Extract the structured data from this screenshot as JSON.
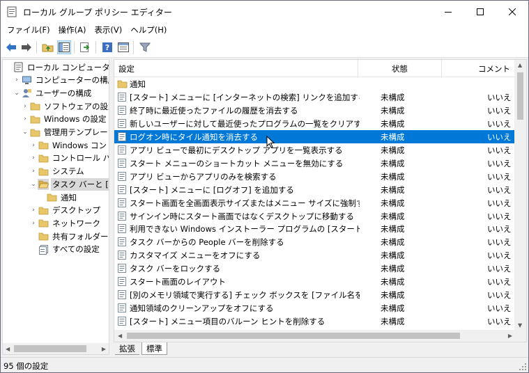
{
  "window": {
    "title": "ローカル グループ ポリシー エディター"
  },
  "menu": [
    "ファイル(F)",
    "操作(A)",
    "表示(V)",
    "ヘルプ(H)"
  ],
  "toolbar": {
    "icons": [
      "back-arrow-icon",
      "forward-arrow-icon",
      "up-folder-icon",
      "show-hide-tree-icon",
      "export-list-icon",
      "help-icon",
      "properties-icon",
      "filter-icon"
    ]
  },
  "tree": [
    {
      "label": "ローカル コンピューター ポリシ",
      "expander": "",
      "icon": "policy-icon",
      "level": 0
    },
    {
      "label": "コンピューターの構成",
      "expander": "›",
      "icon": "computer-icon",
      "level": 1
    },
    {
      "label": "ユーザーの構成",
      "expander": "⌄",
      "icon": "user-icon",
      "level": 1
    },
    {
      "label": "ソフトウェアの設定",
      "expander": "›",
      "icon": "folder-icon",
      "level": 2
    },
    {
      "label": "Windows の設定",
      "expander": "›",
      "icon": "folder-icon",
      "level": 2
    },
    {
      "label": "管理用テンプレート",
      "expander": "⌄",
      "icon": "folder-icon",
      "level": 2
    },
    {
      "label": "Windows コン",
      "expander": "›",
      "icon": "folder-icon",
      "level": 3
    },
    {
      "label": "コントロール パ",
      "expander": "›",
      "icon": "folder-icon",
      "level": 3
    },
    {
      "label": "システム",
      "expander": "›",
      "icon": "folder-icon",
      "level": 3
    },
    {
      "label": "タスク バーと [ス",
      "expander": "⌄",
      "icon": "folder-open-icon",
      "level": 3,
      "selected": true
    },
    {
      "label": "通知",
      "expander": "",
      "icon": "folder-icon",
      "level": 4
    },
    {
      "label": "デスクトップ",
      "expander": "›",
      "icon": "folder-icon",
      "level": 3
    },
    {
      "label": "ネットワーク",
      "expander": "›",
      "icon": "folder-icon",
      "level": 3
    },
    {
      "label": "共有フォルダー",
      "expander": "",
      "icon": "folder-icon",
      "level": 3
    },
    {
      "label": "すべての設定",
      "expander": "",
      "icon": "all-settings-icon",
      "level": 3
    }
  ],
  "list": {
    "columns": [
      "設定",
      "状態",
      "コメント"
    ],
    "rows": [
      {
        "name": "通知",
        "state": "",
        "comment": "",
        "icon": "folder-icon"
      },
      {
        "name": "[スタート] メニューに [インターネットの検索] リンクを追加する",
        "state": "未構成",
        "comment": "いいえ",
        "icon": "setting-icon"
      },
      {
        "name": "終了時に最近使ったファイルの履歴を消去する",
        "state": "未構成",
        "comment": "いいえ",
        "icon": "setting-icon"
      },
      {
        "name": "新しいユーザーに対して最近使ったプログラムの一覧をクリアする",
        "state": "未構成",
        "comment": "いいえ",
        "icon": "setting-icon"
      },
      {
        "name": "ログオン時にタイル通知を消去する",
        "state": "未構成",
        "comment": "いいえ",
        "icon": "setting-icon",
        "selected": true
      },
      {
        "name": "アプリ ビューで最初にデスクトップ アプリを一覧表示する",
        "state": "未構成",
        "comment": "いいえ",
        "icon": "setting-icon"
      },
      {
        "name": "スタート メニューのショートカット メニューを無効にする",
        "state": "未構成",
        "comment": "いいえ",
        "icon": "setting-icon"
      },
      {
        "name": "アプリ ビューからアプリのみを検索する",
        "state": "未構成",
        "comment": "いいえ",
        "icon": "setting-icon"
      },
      {
        "name": "[スタート] メニューに [ログオフ] を追加する",
        "state": "未構成",
        "comment": "いいえ",
        "icon": "setting-icon"
      },
      {
        "name": "スタート画面を全画面表示サイズまたはメニュー サイズに強制する",
        "state": "未構成",
        "comment": "いいえ",
        "icon": "setting-icon"
      },
      {
        "name": "サインイン時にスタート画面ではなくデスクトップに移動する",
        "state": "未構成",
        "comment": "いいえ",
        "icon": "setting-icon"
      },
      {
        "name": "利用できない Windows インストーラー プログラムの [スタート] メニュー...",
        "state": "未構成",
        "comment": "いいえ",
        "icon": "setting-icon"
      },
      {
        "name": "タスク バーからの People バーを削除する",
        "state": "未構成",
        "comment": "いいえ",
        "icon": "setting-icon"
      },
      {
        "name": "カスタマイズ メニューをオフにする",
        "state": "未構成",
        "comment": "いいえ",
        "icon": "setting-icon"
      },
      {
        "name": "タスク バーをロックする",
        "state": "未構成",
        "comment": "いいえ",
        "icon": "setting-icon"
      },
      {
        "name": "スタート画面のレイアウト",
        "state": "未構成",
        "comment": "いいえ",
        "icon": "setting-icon"
      },
      {
        "name": "[別のメモリ領域で実行する] チェック ボックスを [ファイル名を指定し...",
        "state": "未構成",
        "comment": "いいえ",
        "icon": "setting-icon"
      },
      {
        "name": "通知領域のクリーンアップをオフにする",
        "state": "未構成",
        "comment": "いいえ",
        "icon": "setting-icon"
      },
      {
        "name": "[スタート] メニュー項目のバルーン ヒントを削除する",
        "state": "未構成",
        "comment": "いいえ",
        "icon": "setting-icon"
      }
    ]
  },
  "tabs": [
    "拡張",
    "標準"
  ],
  "status": "95 個の設定",
  "colors": {
    "selection": "#0078d7",
    "folder": "#e8c66a"
  }
}
